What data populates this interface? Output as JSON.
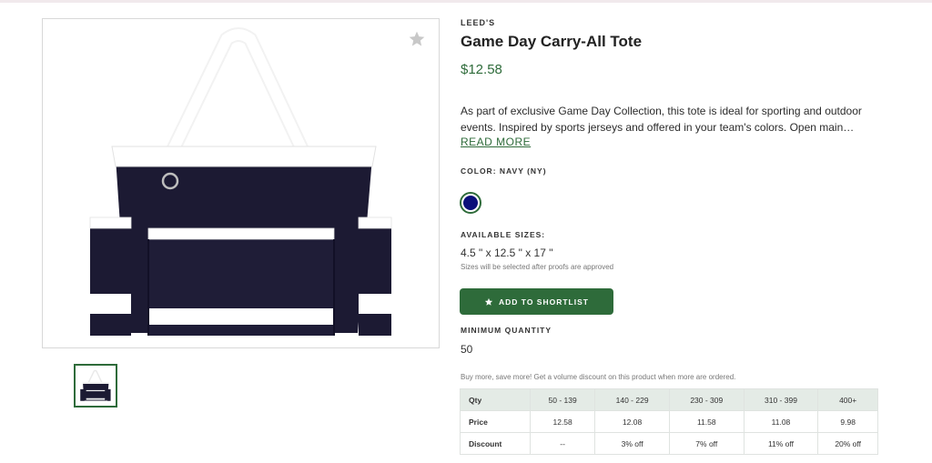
{
  "product": {
    "brand": "LEED'S",
    "title": "Game Day Carry-All Tote",
    "price": "$12.58",
    "description": "As part of exclusive Game Day Collection, this tote is ideal for sporting and outdoor events. Inspired by sports jerseys and offered in your team's colors. Open main…",
    "read_more": "READ MORE",
    "color_label": "COLOR: NAVY (NY)",
    "swatch_color": "#0b0f7a",
    "sizes_label": "AVAILABLE SIZES:",
    "size_value": "4.5 \" x 12.5 \" x 17 \"",
    "size_note": "Sizes will be selected after proofs are approved",
    "shortlist_label": "ADD TO SHORTLIST",
    "min_qty_label": "MINIMUM QUANTITY",
    "min_qty_value": "50",
    "volume_note": "Buy more, save more! Get a volume discount on this product when more are ordered."
  },
  "pricing": {
    "headers": [
      "Qty",
      "50 - 139",
      "140 - 229",
      "230 - 309",
      "310 - 399",
      "400+"
    ],
    "price_row": [
      "Price",
      "12.58",
      "12.08",
      "11.58",
      "11.08",
      "9.98"
    ],
    "discount_row": [
      "Discount",
      "--",
      "3% off",
      "7% off",
      "11% off",
      "20% off"
    ]
  },
  "icons": {
    "favorite": "star-icon",
    "shortlist": "star-icon"
  },
  "colors": {
    "accent": "#2e6b3a",
    "bag_navy": "#1c1a33",
    "table_header_bg": "#e4ebe6"
  }
}
